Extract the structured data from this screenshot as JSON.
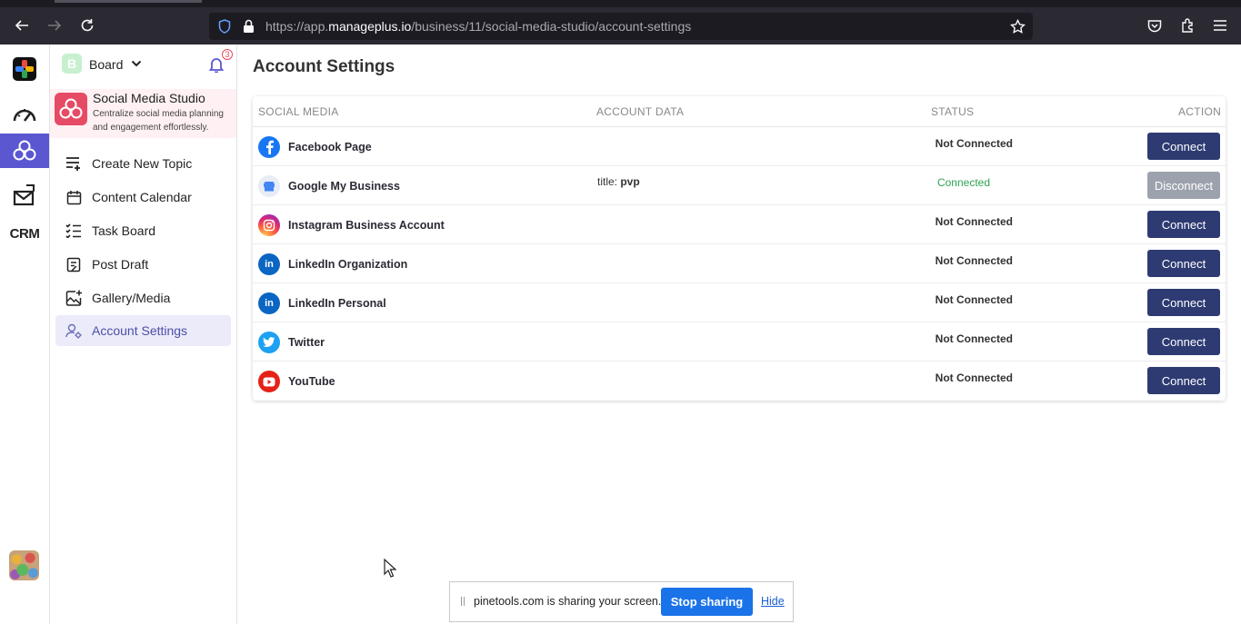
{
  "browser": {
    "url_prefix": "https://app.",
    "url_domain": "manageplus.io",
    "url_path": "/business/11/social-media-studio/account-settings"
  },
  "rail": {
    "items": [
      {
        "icon": "app-logo-icon"
      },
      {
        "icon": "dashboard-gauge-icon"
      },
      {
        "icon": "social-studio-icon"
      },
      {
        "icon": "mail-campaign-icon"
      },
      {
        "icon": "crm-icon"
      }
    ],
    "crm_label": "CRM"
  },
  "sidebar": {
    "board_badge": "B",
    "board_label": "Board",
    "notification_count": "3",
    "studio_title": "Social Media Studio",
    "studio_desc": "Centralize social media planning and engagement effortlessly.",
    "items": [
      {
        "label": "Create New Topic",
        "icon": "playlist-add-icon"
      },
      {
        "label": "Content Calendar",
        "icon": "calendar-icon"
      },
      {
        "label": "Task Board",
        "icon": "checklist-icon"
      },
      {
        "label": "Post Draft",
        "icon": "draft-doc-icon"
      },
      {
        "label": "Gallery/Media",
        "icon": "gallery-add-icon"
      },
      {
        "label": "Account Settings",
        "icon": "user-settings-icon"
      }
    ]
  },
  "main": {
    "title": "Account Settings",
    "columns": [
      "SOCIAL MEDIA",
      "ACCOUNT DATA",
      "STATUS",
      "ACTION"
    ],
    "rows": [
      {
        "name": "Facebook Page",
        "data_key": "",
        "data_val": "",
        "status": "Not Connected",
        "action": "Connect",
        "icon": "facebook-icon",
        "color": "#1877f2"
      },
      {
        "name": "Google My Business",
        "data_key": "title: ",
        "data_val": "pvp",
        "status": "Connected",
        "action": "Disconnect",
        "icon": "google-my-business-icon",
        "color": "#4285f4"
      },
      {
        "name": "Instagram Business Account",
        "data_key": "",
        "data_val": "",
        "status": "Not Connected",
        "action": "Connect",
        "icon": "instagram-icon",
        "color": "#e1306c"
      },
      {
        "name": "LinkedIn Organization",
        "data_key": "",
        "data_val": "",
        "status": "Not Connected",
        "action": "Connect",
        "icon": "linkedin-icon",
        "color": "#0a66c2"
      },
      {
        "name": "LinkedIn Personal",
        "data_key": "",
        "data_val": "",
        "status": "Not Connected",
        "action": "Connect",
        "icon": "linkedin-icon",
        "color": "#0a66c2"
      },
      {
        "name": "Twitter",
        "data_key": "",
        "data_val": "",
        "status": "Not Connected",
        "action": "Connect",
        "icon": "twitter-icon",
        "color": "#1da1f2"
      },
      {
        "name": "YouTube",
        "data_key": "",
        "data_val": "",
        "status": "Not Connected",
        "action": "Connect",
        "icon": "youtube-icon",
        "color": "#e62117"
      }
    ]
  },
  "sharebar": {
    "text": "pinetools.com is sharing your screen.",
    "stop_label": "Stop sharing",
    "hide_label": "Hide"
  },
  "colors": {
    "accent": "#5b57d1",
    "button": "#2e3b73",
    "connected": "#2ea44f",
    "studio_brand": "#e64b66"
  }
}
